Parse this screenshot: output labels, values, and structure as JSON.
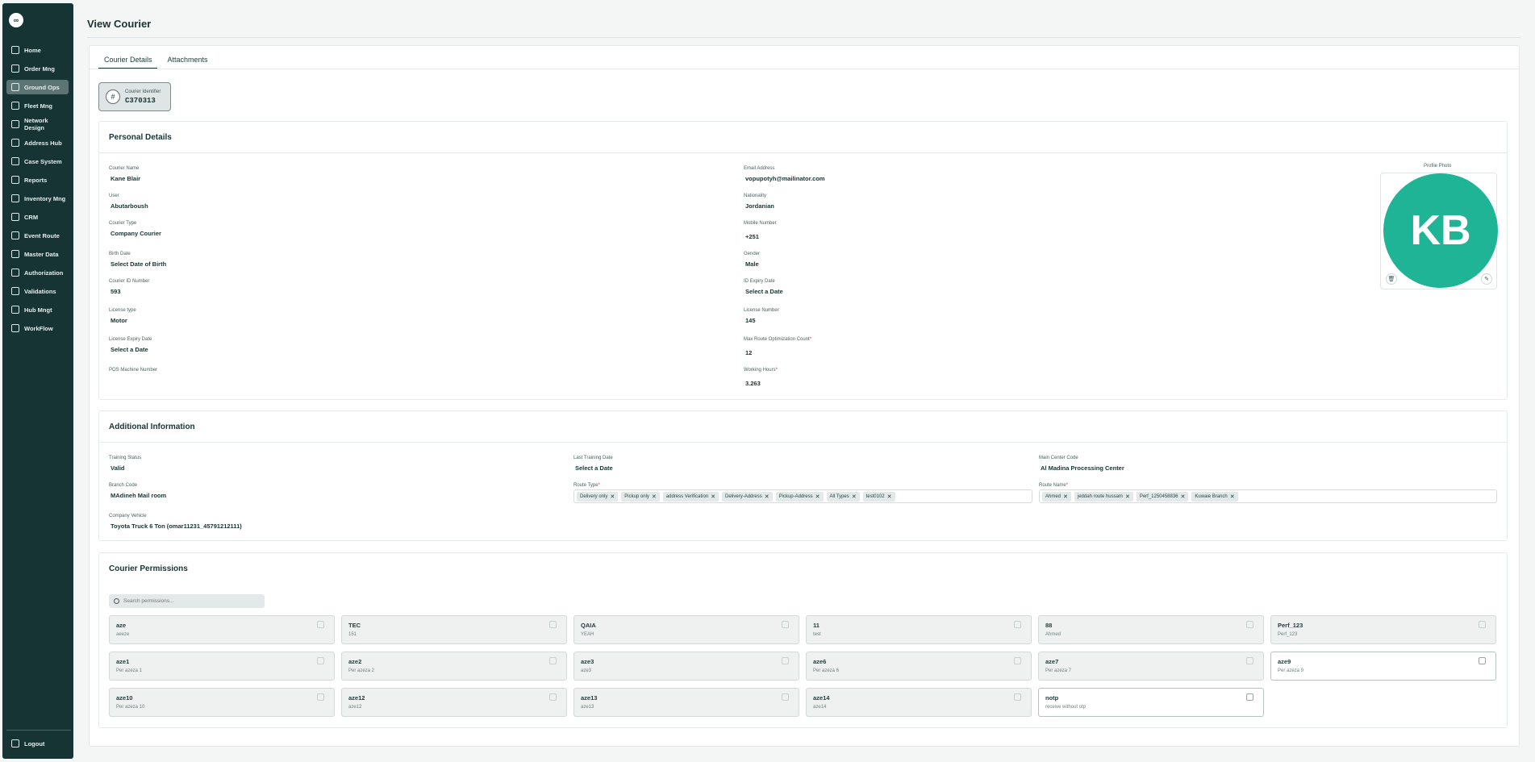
{
  "sidebar": {
    "logo": "∞",
    "items": [
      {
        "label": "Home",
        "icon": "home-icon"
      },
      {
        "label": "Order Mng",
        "icon": "order-icon"
      },
      {
        "label": "Ground Ops",
        "icon": "ground-ops-icon"
      },
      {
        "label": "Fleet Mng",
        "icon": "truck-icon"
      },
      {
        "label": "Network Design",
        "icon": "network-icon"
      },
      {
        "label": "Address Hub",
        "icon": "location-icon"
      },
      {
        "label": "Case System",
        "icon": "case-icon"
      },
      {
        "label": "Reports",
        "icon": "report-icon"
      },
      {
        "label": "Inventory Mng",
        "icon": "inventory-icon"
      },
      {
        "label": "CRM",
        "icon": "crm-icon"
      },
      {
        "label": "Event Route",
        "icon": "event-icon"
      },
      {
        "label": "Master Data",
        "icon": "database-icon"
      },
      {
        "label": "Authorization",
        "icon": "users-icon"
      },
      {
        "label": "Validations",
        "icon": "validation-icon"
      },
      {
        "label": "Hub Mngt",
        "icon": "hub-icon"
      },
      {
        "label": "WorkFlow",
        "icon": "workflow-icon"
      }
    ],
    "active_index": 2,
    "logout": "Logout"
  },
  "page": {
    "title": "View Courier"
  },
  "tabs": [
    "Courier Details",
    "Attachments"
  ],
  "identifier": {
    "label": "Courier Identifier",
    "value": "C370313",
    "icon": "#"
  },
  "personal": {
    "title": "Personal Details",
    "photo_label": "Profile Photo",
    "initials": "KB",
    "fields": [
      {
        "label": "Courier Name",
        "value": "Kane Blair"
      },
      {
        "label": "User",
        "value": "Abutarboush"
      },
      {
        "label": "Courier Type",
        "value": "Company Courier"
      },
      {
        "label": "Birth Date",
        "value": "Select Date of Birth"
      },
      {
        "label": "Courier ID Number",
        "value": "593"
      },
      {
        "label": "License type",
        "value": "Motor"
      },
      {
        "label": "License Expiry Date",
        "value": "Select a Date"
      },
      {
        "label": "POS Machine Number",
        "value": ""
      },
      {
        "label": "Email Address",
        "value": "vopupotyh@mailinator.com"
      },
      {
        "label": "Nationality",
        "value": "Jordanian"
      },
      {
        "label": "Mobile Number",
        "value": "+251"
      },
      {
        "label": "Gender",
        "value": "Male"
      },
      {
        "label": "ID Expiry Date",
        "value": "Select a Date"
      },
      {
        "label": "License Number",
        "value": "145"
      },
      {
        "label": "Max Route Optimization Count",
        "value": "12",
        "required": "*"
      },
      {
        "label": "Working Hours",
        "value": "3.263",
        "required": "*"
      }
    ]
  },
  "additional": {
    "title": "Additional Information",
    "fields": [
      {
        "label": "Training Status",
        "value": "Valid"
      },
      {
        "label": "Last Training Date",
        "value": "Select a Date"
      },
      {
        "label": "Main Center Code",
        "value": "Al Madina Processing Center"
      },
      {
        "label": "Branch Code",
        "value": "MAdineh Mail room"
      },
      {
        "label": "Company Vehicle",
        "value": "Toyota Truck 6 Ton (omar11231_45791212111)"
      }
    ],
    "route_type": {
      "label": "Route Type",
      "required": "*",
      "chips": [
        "Delivery only",
        "Pickup only",
        "address Verification",
        "Delivery-Address",
        "Pickup-Address",
        "All Types",
        "test0102"
      ]
    },
    "route_name": {
      "label": "Route Name",
      "required": "*",
      "chips": [
        "Ahmed",
        "jeddah route hussam",
        "Perf_1250458836",
        "Kuwaie Branch"
      ]
    }
  },
  "permissions": {
    "title": "Courier Permissions",
    "search_placeholder": "Search permissions...",
    "items": [
      {
        "name": "aze",
        "desc": "aeeze",
        "enabled": false
      },
      {
        "name": "TEC",
        "desc": "151",
        "enabled": false
      },
      {
        "name": "QAIA",
        "desc": "YEAH",
        "enabled": false
      },
      {
        "name": "11",
        "desc": "test",
        "enabled": false
      },
      {
        "name": "88",
        "desc": "Ahmed",
        "enabled": false
      },
      {
        "name": "Perf_123",
        "desc": "Perf_123",
        "enabled": false
      },
      {
        "name": "aze1",
        "desc": "Per azeza 1",
        "enabled": false
      },
      {
        "name": "aze2",
        "desc": "Per azeza 2",
        "enabled": false
      },
      {
        "name": "aze3",
        "desc": "aze3",
        "enabled": false
      },
      {
        "name": "aze6",
        "desc": "Per azeza 6",
        "enabled": false
      },
      {
        "name": "aze7",
        "desc": "Per azeza 7",
        "enabled": false
      },
      {
        "name": "aze9",
        "desc": "Per azeza 9",
        "enabled": true
      },
      {
        "name": "aze10",
        "desc": "Per azeza 10",
        "enabled": false
      },
      {
        "name": "aze12",
        "desc": "aze12",
        "enabled": false
      },
      {
        "name": "aze13",
        "desc": "aze13",
        "enabled": false
      },
      {
        "name": "aze14",
        "desc": "aze14",
        "enabled": false
      },
      {
        "name": "notp",
        "desc": "receive without otp",
        "enabled": true
      }
    ]
  }
}
